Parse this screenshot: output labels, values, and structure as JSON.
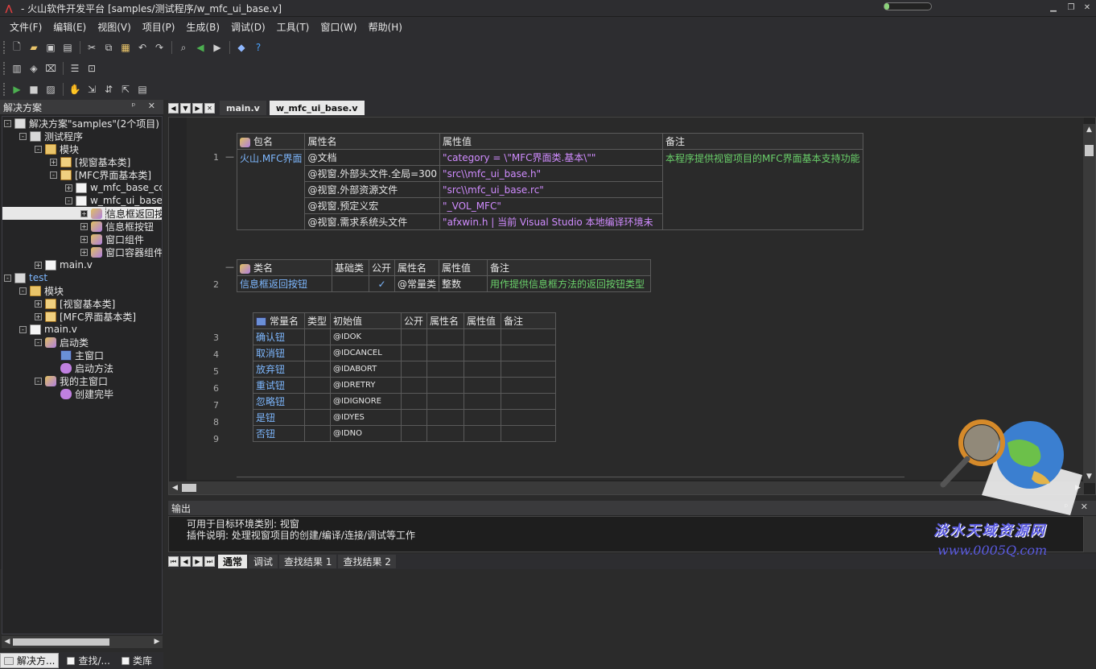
{
  "window": {
    "title": "- 火山软件开发平台 [samples/测试程序/w_mfc_ui_base.v]"
  },
  "menu": [
    "文件(F)",
    "编辑(E)",
    "视图(V)",
    "项目(P)",
    "生成(B)",
    "调试(D)",
    "工具(T)",
    "窗口(W)",
    "帮助(H)"
  ],
  "solution_panel": {
    "title": "解决方案",
    "tree": [
      {
        "indent": 0,
        "exp": "-",
        "icon": "sln",
        "label": "解决方案\"samples\"(2个项目)"
      },
      {
        "indent": 1,
        "exp": "-",
        "icon": "proj",
        "label": "测试程序"
      },
      {
        "indent": 2,
        "exp": "-",
        "icon": "folder",
        "label": "模块"
      },
      {
        "indent": 3,
        "exp": "+",
        "icon": "mod",
        "label": "[视窗基本类]"
      },
      {
        "indent": 3,
        "exp": "-",
        "icon": "mod",
        "label": "[MFC界面基本类]"
      },
      {
        "indent": 4,
        "exp": "+",
        "icon": "file",
        "label": "w_mfc_base_contro"
      },
      {
        "indent": 4,
        "exp": "-",
        "icon": "file",
        "label": "w_mfc_ui_base.v"
      },
      {
        "indent": 5,
        "exp": "+",
        "icon": "cls",
        "label": "信息框返回按钮",
        "selected": true
      },
      {
        "indent": 5,
        "exp": "+",
        "icon": "cls",
        "label": "信息框按钮"
      },
      {
        "indent": 5,
        "exp": "+",
        "icon": "cls",
        "label": "窗口组件"
      },
      {
        "indent": 5,
        "exp": "+",
        "icon": "cls",
        "label": "窗口容器组件"
      },
      {
        "indent": 2,
        "exp": "+",
        "icon": "file",
        "label": "main.v"
      },
      {
        "indent": 0,
        "exp": "-",
        "icon": "proj",
        "label": "test",
        "blue": true
      },
      {
        "indent": 1,
        "exp": "-",
        "icon": "folder",
        "label": "模块"
      },
      {
        "indent": 2,
        "exp": "+",
        "icon": "mod",
        "label": "[视窗基本类]"
      },
      {
        "indent": 2,
        "exp": "+",
        "icon": "mod",
        "label": "[MFC界面基本类]"
      },
      {
        "indent": 1,
        "exp": "-",
        "icon": "file",
        "label": "main.v"
      },
      {
        "indent": 2,
        "exp": "-",
        "icon": "cls",
        "label": "启动类"
      },
      {
        "indent": 3,
        "exp": "",
        "icon": "win",
        "label": "主窗口"
      },
      {
        "indent": 3,
        "exp": "",
        "icon": "meth",
        "label": "启动方法"
      },
      {
        "indent": 2,
        "exp": "-",
        "icon": "cls",
        "label": "我的主窗口"
      },
      {
        "indent": 3,
        "exp": "",
        "icon": "meth",
        "label": "创建完毕"
      }
    ],
    "tabs": [
      "解决方...",
      "查找/...",
      "类库"
    ]
  },
  "doc_tabs": [
    "main.v",
    "w_mfc_ui_base.v"
  ],
  "editor": {
    "pkg_table": {
      "headers": [
        "包名",
        "属性名",
        "属性值",
        "备注"
      ],
      "pkg_name": "火山.MFC界面",
      "rows": [
        {
          "name": "@文档",
          "value": "\"category = \\\"MFC界面类.基本\\\"\""
        },
        {
          "name": "@视窗.外部头文件.全局=300",
          "value": "\"src\\\\mfc_ui_base.h\""
        },
        {
          "name": "@视窗.外部资源文件",
          "value": "\"src\\\\mfc_ui_base.rc\""
        },
        {
          "name": "@视窗.预定义宏",
          "value": "\"_VOL_MFC\""
        },
        {
          "name": "@视窗.需求系统头文件",
          "value": "\"afxwin.h | 当前 Visual Studio 本地编译环境未"
        }
      ],
      "remark": "本程序提供视窗项目的MFC界面基本支持功能"
    },
    "class_table": {
      "headers": [
        "类名",
        "基础类",
        "公开",
        "属性名",
        "属性值",
        "备注"
      ],
      "row": {
        "name": "信息框返回按钮",
        "base": "",
        "public": "✓",
        "attr": "@常量类",
        "value": "整数",
        "remark": "用作提供信息框方法的返回按钮类型"
      }
    },
    "const_table": {
      "headers": [
        "常量名",
        "类型",
        "初始值",
        "公开",
        "属性名",
        "属性值",
        "备注"
      ],
      "rows": [
        {
          "name": "确认钮",
          "init": "@IDOK"
        },
        {
          "name": "取消钮",
          "init": "@IDCANCEL"
        },
        {
          "name": "放弃钮",
          "init": "@IDABORT"
        },
        {
          "name": "重试钮",
          "init": "@IDRETRY"
        },
        {
          "name": "忽略钮",
          "init": "@IDIGNORE"
        },
        {
          "name": "是钮",
          "init": "@IDYES"
        },
        {
          "name": "否钮",
          "init": "@IDNO"
        }
      ]
    },
    "line_numbers": [
      "1",
      "2",
      "3",
      "4",
      "5",
      "6",
      "7",
      "8",
      "9"
    ]
  },
  "output": {
    "title": "输出",
    "lines": [
      "可用于目标环境类别: 视窗",
      "插件说明: 处理视窗项目的创建/编译/连接/调试等工作"
    ]
  },
  "bottom_tabs": [
    "通常",
    "调试",
    "查找结果 1",
    "查找结果 2"
  ],
  "watermark": {
    "text": "淡水天域资源网",
    "url": "www.0005Q.com"
  },
  "colors": {
    "accent_blue": "#7eb8ff",
    "string_purple": "#d08cff",
    "comment_green": "#6ad06a"
  }
}
